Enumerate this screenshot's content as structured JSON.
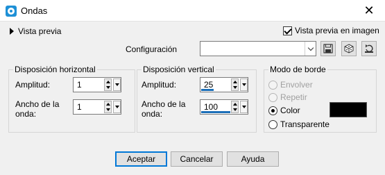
{
  "window": {
    "title": "Ondas",
    "close": "✕"
  },
  "preview": {
    "label": "Vista previa",
    "checkbox_label": "Vista previa en imagen",
    "checked": true
  },
  "config": {
    "label": "Configuración",
    "value": ""
  },
  "horizontal": {
    "title": "Disposición horizontal",
    "amplitude_label": "Amplitud:",
    "amplitude_value": "1",
    "wavelength_label_1": "Ancho de la",
    "wavelength_label_2": "onda:",
    "wavelength_value": "1"
  },
  "vertical": {
    "title": "Disposición vertical",
    "amplitude_label": "Amplitud:",
    "amplitude_value": "25",
    "wavelength_label_1": "Ancho de la",
    "wavelength_label_2": "onda:",
    "wavelength_value": "100"
  },
  "edge_mode": {
    "title": "Modo de borde",
    "options": [
      "Envolver",
      "Repetir",
      "Color",
      "Transparente"
    ],
    "selected": "Color",
    "color": "#000000"
  },
  "buttons": {
    "ok": "Aceptar",
    "cancel": "Cancelar",
    "help": "Ayuda"
  },
  "colors": {
    "accent": "#0078d7",
    "level_bar": "#1c6fb8"
  }
}
